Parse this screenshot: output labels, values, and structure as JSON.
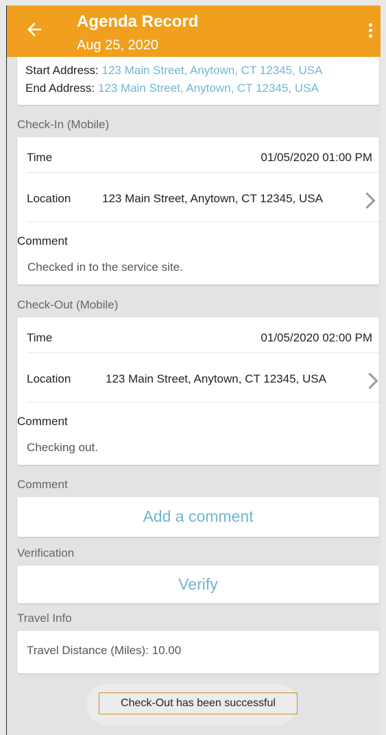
{
  "header": {
    "title": "Agenda Record",
    "date": "Aug 25, 2020",
    "back_icon": "arrow-left-icon",
    "menu_icon": "more-vertical-icon"
  },
  "addresses": {
    "start_label": "Start Address:",
    "start_value": "123 Main Street, Anytown, CT 12345, USA",
    "end_label": "End Address:",
    "end_value": "123 Main Street, Anytown, CT 12345, USA"
  },
  "checkin": {
    "section_label": "Check-In (Mobile)",
    "time_label": "Time",
    "time_value": "01/05/2020 01:00 PM",
    "location_label": "Location",
    "location_value": "123 Main Street, Anytown, CT 12345, USA",
    "comment_label": "Comment",
    "comment_value": "Checked in to the service site."
  },
  "checkout": {
    "section_label": "Check-Out (Mobile)",
    "time_label": "Time",
    "time_value": "01/05/2020 02:00 PM",
    "location_label": "Location",
    "location_value": "123 Main Street, Anytown, CT 12345, USA",
    "comment_label": "Comment",
    "comment_value": "Checking out."
  },
  "comment_section": {
    "label": "Comment",
    "button": "Add a comment"
  },
  "verification": {
    "label": "Verification",
    "button": "Verify"
  },
  "travel": {
    "label": "Travel Info",
    "distance": "Travel Distance (Miles): 10.00"
  },
  "toast": {
    "message": "Check-Out has been successful"
  },
  "colors": {
    "accent": "#f0a01e",
    "link": "#6fb6d2",
    "toast_border": "#d58b1e"
  }
}
